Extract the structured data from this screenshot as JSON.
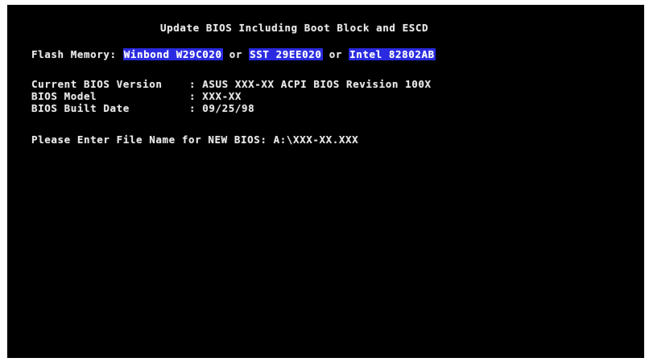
{
  "title": "Update BIOS Including Boot Block and ESCD",
  "flash": {
    "label": "Flash Memory: ",
    "chip1": "Winbond W29C020",
    "sep1": " or ",
    "chip2": "SST 29EE020",
    "sep2": " or ",
    "chip3": "Intel 82802AB"
  },
  "bios_info": [
    {
      "key": "Current BIOS Version",
      "sep": ": ",
      "value": "ASUS XXX-XX ACPI BIOS Revision 100X"
    },
    {
      "key": "BIOS Model",
      "sep": ": ",
      "value": "XXX-XX"
    },
    {
      "key": "BIOS Built Date",
      "sep": ": ",
      "value": "09/25/98"
    }
  ],
  "prompt": {
    "label": "Please Enter File Name for NEW BIOS: ",
    "value": "A:\\XXX-XX.XXX"
  },
  "colors": {
    "screen_bg": "#000000",
    "text": "#e8e8e8",
    "highlight_bg": "#2a2ae0"
  }
}
